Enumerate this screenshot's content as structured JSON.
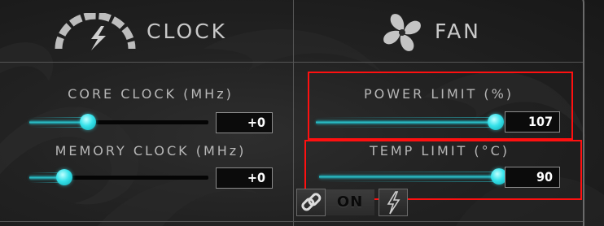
{
  "header": {
    "clock_label": "CLOCK",
    "fan_label": "FAN"
  },
  "sliders": {
    "core_clock": {
      "label": "CORE CLOCK (MHz)",
      "value": "+0",
      "level": 0.37
    },
    "memory_clock": {
      "label": "MEMORY CLOCK (MHz)",
      "value": "+0",
      "level": 0.2
    },
    "power_limit": {
      "label": "POWER LIMIT (%)",
      "value": "107",
      "level": 1.0
    },
    "temp_limit": {
      "label": "TEMP LIMIT (°C)",
      "value": "90",
      "level": 1.0
    }
  },
  "link_controls": {
    "link_icon": "link-icon",
    "toggle_label": "ON",
    "apply_icon": "lightning-icon"
  },
  "colors": {
    "accent": "#2cc7cf",
    "highlight_box": "#ff1010",
    "value_text": "#ffffff",
    "label_text": "#b7b7b7"
  }
}
